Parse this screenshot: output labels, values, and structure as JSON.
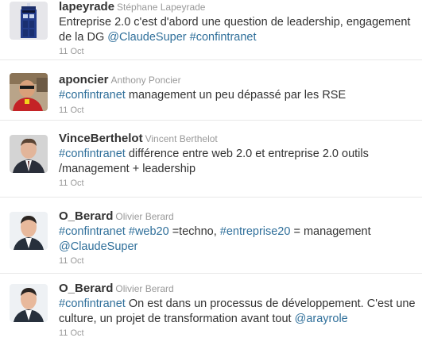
{
  "tweets": [
    {
      "screen_name": "lapeyrade",
      "full_name": "Stéphane Lapeyrade",
      "avatar_icon": "police-box-icon",
      "parts": [
        {
          "t": "text",
          "v": "Entreprise 2.0 c'est d'abord une question de leadership, engagement de la DG "
        },
        {
          "t": "mention",
          "v": "@ClaudeSuper"
        },
        {
          "t": "text",
          "v": " "
        },
        {
          "t": "hashtag",
          "v": "#confintranet"
        }
      ],
      "time": "11 Oct"
    },
    {
      "screen_name": "aponcier",
      "full_name": "Anthony Poncier",
      "avatar_icon": "user-photo-red-shirt-icon",
      "parts": [
        {
          "t": "hashtag",
          "v": "#confintranet"
        },
        {
          "t": "text",
          "v": " management un peu dépassé par les RSE"
        }
      ],
      "time": "11 Oct"
    },
    {
      "screen_name": "VinceBerthelot",
      "full_name": "Vincent Berthelot",
      "avatar_icon": "user-photo-suit-icon",
      "parts": [
        {
          "t": "hashtag",
          "v": "#confintranet"
        },
        {
          "t": "text",
          "v": " différence entre web 2.0 et entreprise 2.0 outils /management + leadership"
        }
      ],
      "time": "11 Oct"
    },
    {
      "screen_name": "O_Berard",
      "full_name": "Olivier Berard",
      "avatar_icon": "user-photo-icon",
      "parts": [
        {
          "t": "hashtag",
          "v": "#confintranet"
        },
        {
          "t": "text",
          "v": " "
        },
        {
          "t": "hashtag",
          "v": "#web20"
        },
        {
          "t": "text",
          "v": " =techno, "
        },
        {
          "t": "hashtag",
          "v": "#entreprise20"
        },
        {
          "t": "text",
          "v": " = management "
        },
        {
          "t": "mention",
          "v": "@ClaudeSuper"
        }
      ],
      "time": "11 Oct"
    },
    {
      "screen_name": "O_Berard",
      "full_name": "Olivier Berard",
      "avatar_icon": "user-photo-icon",
      "parts": [
        {
          "t": "hashtag",
          "v": "#confintranet"
        },
        {
          "t": "text",
          "v": " On est dans un processus de développement. C'est une culture, un projet de transformation avant tout "
        },
        {
          "t": "mention",
          "v": "@arayrole"
        }
      ],
      "time": "11 Oct"
    }
  ],
  "colors": {
    "link": "#2f6f9a",
    "meta": "#999999",
    "text": "#333333",
    "divider": "#e8e8e8"
  }
}
